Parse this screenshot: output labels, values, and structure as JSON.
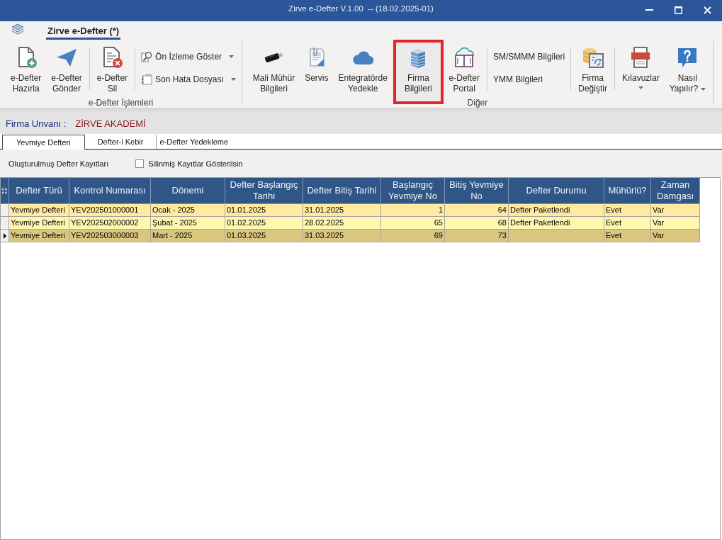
{
  "window": {
    "title": "Zirve e-Defter V.1.00  -- (18.02.2025-01)"
  },
  "ribbon": {
    "tabs": [
      {
        "label": "Zirve e-Defter (*)",
        "selected": true
      }
    ],
    "groups": [
      {
        "label": "e-Defter İşlemleri",
        "sections": [
          {
            "items": [
              {
                "kind": "large",
                "label": "e-Defter\nHazırla",
                "dropdown": false,
                "highlighted": false
              },
              {
                "kind": "large",
                "label": "e-Defter\nGönder",
                "dropdown": false,
                "highlighted": false
              }
            ]
          },
          {
            "items": [
              {
                "kind": "large",
                "label": "e-Defter\nSil",
                "dropdown": false,
                "highlighted": false
              }
            ]
          },
          {
            "items": [
              {
                "kind": "small",
                "label": "Ön İzleme Göster",
                "dropdown": true
              },
              {
                "kind": "small",
                "label": "Son Hata Dosyası",
                "dropdown": true
              }
            ]
          }
        ]
      },
      {
        "label": "Diğer",
        "sections": [
          {
            "items": [
              {
                "kind": "large",
                "label": "Mali Mühür\nBilgileri",
                "dropdown": false,
                "highlighted": false
              },
              {
                "kind": "large",
                "label": "Servis",
                "dropdown": false,
                "highlighted": false
              },
              {
                "kind": "large",
                "label": "Entegratörde\nYedekle",
                "dropdown": false,
                "highlighted": false
              },
              {
                "kind": "large",
                "label": "Firma\nBilgileri",
                "dropdown": false,
                "highlighted": true
              },
              {
                "kind": "large",
                "label": "e-Defter\nPortal",
                "dropdown": false,
                "highlighted": false
              }
            ]
          },
          {
            "items": [
              {
                "kind": "small",
                "label": "SM/SMMM Bilgileri",
                "dropdown": false
              },
              {
                "kind": "small",
                "label": "YMM Bilgileri",
                "dropdown": false
              }
            ]
          },
          {
            "items": [
              {
                "kind": "large",
                "label": "Firma\nDeğiştir",
                "dropdown": false,
                "highlighted": false
              }
            ]
          },
          {
            "items": [
              {
                "kind": "large",
                "label": "Kılavuzlar",
                "dropdown": true,
                "highlighted": false
              },
              {
                "kind": "large",
                "label": "Nasıl\nYapılır?",
                "dropdown": true,
                "highlighted": false
              }
            ]
          }
        ]
      }
    ]
  },
  "company": {
    "label": "Firma Unvanı :",
    "value": "ZİRVE AKADEMİ"
  },
  "tabs": [
    {
      "label": "Yevmiye Defteri",
      "selected": true
    },
    {
      "label": "Defter-i Kebir",
      "selected": false
    },
    {
      "label": "e-Defter Yedekleme",
      "selected": false
    }
  ],
  "records": {
    "title": "Oluşturulmuş Defter Kayıtları",
    "show_deleted": {
      "label": "Silinmiş Kayıtlar Gösterilsin",
      "checked": false
    }
  },
  "table": {
    "columns": [
      "Defter Türü",
      "Kontrol Numarası",
      "Dönemi",
      "Defter Başlangıç Tarihi",
      "Defter Bitiş Tarihi",
      "Başlangıç Yevmiye No",
      "Bitiş Yevmiye No",
      "Defter Durumu",
      "Mühürlü?",
      "Zaman Damgası"
    ],
    "rows": [
      {
        "selected": false,
        "cells": [
          "Yevmiye Defteri",
          "YEV202501000001",
          "Ocak - 2025",
          "01.01.2025",
          "31.01.2025",
          "1",
          "64",
          "Defter Paketlendi",
          "Evet",
          "Var"
        ]
      },
      {
        "selected": false,
        "cells": [
          "Yevmiye Defteri",
          "YEV202502000002",
          "Şubat - 2025",
          "01.02.2025",
          "28.02.2025",
          "65",
          "68",
          "Defter Paketlendi",
          "Evet",
          "Var"
        ]
      },
      {
        "selected": true,
        "cells": [
          "Yevmiye Defteri",
          "YEV202503000003",
          "Mart - 2025",
          "01.03.2025",
          "31.03.2025",
          "69",
          "73",
          null,
          "Evet",
          "Var"
        ]
      }
    ]
  }
}
